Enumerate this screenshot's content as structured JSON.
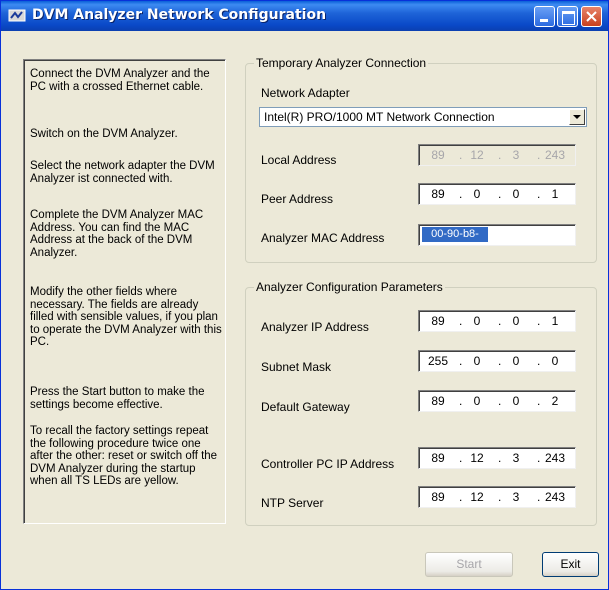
{
  "window": {
    "title": "DVM Analyzer Network Configuration"
  },
  "instructions": {
    "paragraphs": [
      "Connect the DVM Analyzer and the PC with a crossed Ethernet cable.",
      "Switch on the DVM Analyzer.",
      "Select the network adapter the DVM Analyzer ist connected with.",
      "Complete the DVM Analyzer MAC Address. You can find the MAC Address at the back of the DVM Analyzer.",
      "Modify the other fields where necessary. The fields are already filled with sensible values, if you plan to operate the DVM Analyzer with this PC.",
      "Press the Start button to make the settings become effective.",
      "To recall the factory settings repeat the following procedure twice one after the other: reset or switch off the DVM Analyzer during the startup when all TS LEDs are yellow."
    ]
  },
  "temporary": {
    "legend": "Temporary Analyzer Connection",
    "adapter_label": "Network Adapter",
    "adapter_value": "Intel(R) PRO/1000 MT Network Connection",
    "local_label": "Local Address",
    "local_ip": [
      "89",
      "12",
      "3",
      "243"
    ],
    "peer_label": "Peer Address",
    "peer_ip": [
      "89",
      "0",
      "0",
      "1"
    ],
    "mac_label": "Analyzer MAC Address",
    "mac_value": "00-90-b8-"
  },
  "config": {
    "legend": "Analyzer Configuration Parameters",
    "analyzer_ip_label": "Analyzer IP Address",
    "analyzer_ip": [
      "89",
      "0",
      "0",
      "1"
    ],
    "subnet_label": "Subnet Mask",
    "subnet": [
      "255",
      "0",
      "0",
      "0"
    ],
    "gateway_label": "Default Gateway",
    "gateway": [
      "89",
      "0",
      "0",
      "2"
    ],
    "controller_label": "Controller PC IP Address",
    "controller_ip": [
      "89",
      "12",
      "3",
      "243"
    ],
    "ntp_label": "NTP Server",
    "ntp_ip": [
      "89",
      "12",
      "3",
      "243"
    ]
  },
  "buttons": {
    "start": "Start",
    "exit": "Exit"
  },
  "colors": {
    "title_bar": "#0a49c8",
    "dialog_bg": "#ece9d8",
    "selection": "#316ac5",
    "disabled_text": "#a7a6aa"
  },
  "icons": {
    "window": "app-icon",
    "minimize": "minimize-icon",
    "maximize": "maximize-icon",
    "close": "close-icon",
    "dropdown": "chevron-down-icon"
  }
}
